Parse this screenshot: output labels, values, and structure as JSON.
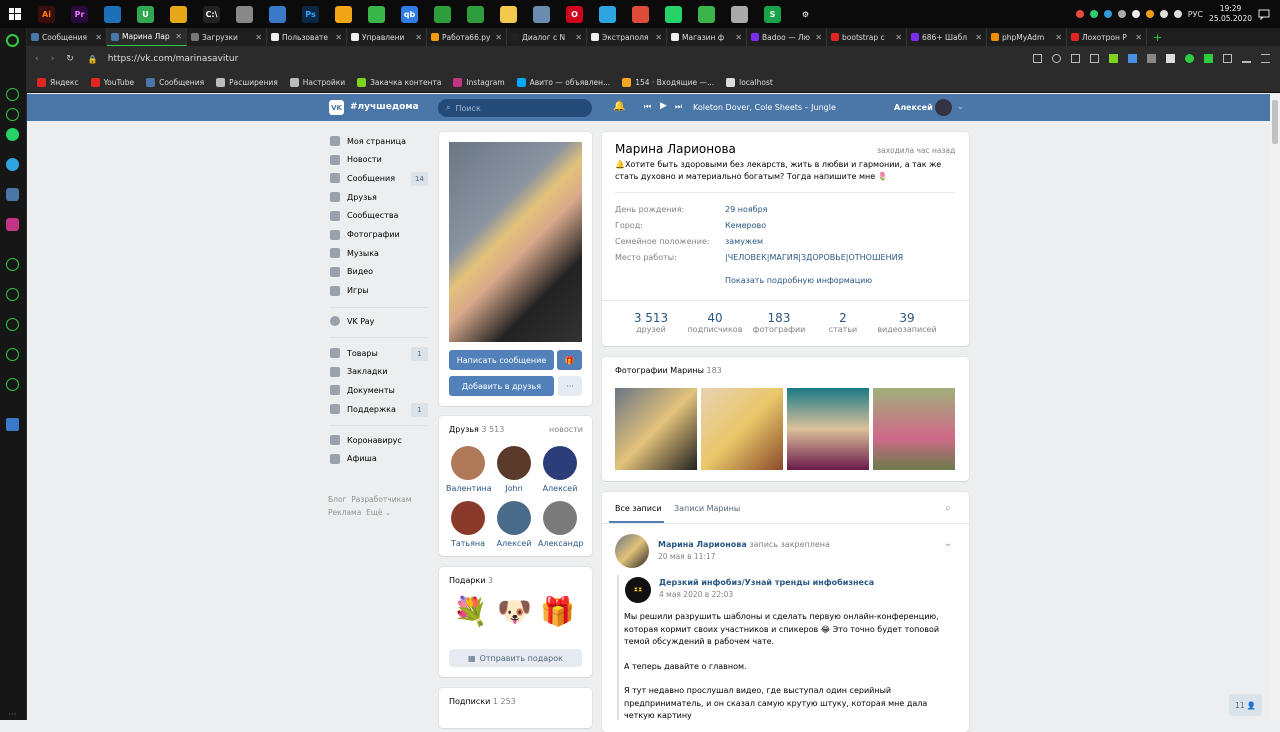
{
  "taskbar": {
    "apps": [
      {
        "label": "Ai",
        "color": "#3b0d0d",
        "fg": "#ff7c00"
      },
      {
        "label": "Pr",
        "color": "#2a0a3d",
        "fg": "#e77bff"
      },
      {
        "label": "",
        "color": "#1d6fb8",
        "fg": "#fff"
      },
      {
        "label": "U",
        "color": "#2fa84f",
        "fg": "#fff"
      },
      {
        "label": "",
        "color": "#e6a817",
        "fg": "#fff"
      },
      {
        "label": "C:\\",
        "color": "#222",
        "fg": "#fff"
      },
      {
        "label": "",
        "color": "#888",
        "fg": "#fff"
      },
      {
        "label": "",
        "color": "#3a78c8",
        "fg": "#fff"
      },
      {
        "label": "Ps",
        "color": "#0b2946",
        "fg": "#31a8ff"
      },
      {
        "label": "",
        "color": "#f2a516",
        "fg": "#fff"
      },
      {
        "label": "",
        "color": "#39b54a",
        "fg": "#fff"
      },
      {
        "label": "qb",
        "color": "#2f7de1",
        "fg": "#fff"
      },
      {
        "label": "",
        "color": "#2e9e3d",
        "fg": "#fff"
      },
      {
        "label": "",
        "color": "#2e9e3d",
        "fg": "#fff"
      },
      {
        "label": "",
        "color": "#f2c94c",
        "fg": "#fff"
      },
      {
        "label": "",
        "color": "#6b8cae",
        "fg": "#fff"
      },
      {
        "label": "O",
        "color": "#d0021b",
        "fg": "#fff"
      },
      {
        "label": "",
        "color": "#2ca5e0",
        "fg": "#fff"
      },
      {
        "label": "",
        "color": "#dd4b39",
        "fg": "#fff"
      },
      {
        "label": "",
        "color": "#25d366",
        "fg": "#fff"
      },
      {
        "label": "",
        "color": "#39b54a",
        "fg": "#fff"
      },
      {
        "label": "",
        "color": "#aaa",
        "fg": "#fff"
      },
      {
        "label": "S",
        "color": "#16a34a",
        "fg": "#fff"
      },
      {
        "label": "⚙",
        "color": "#0b0b0b",
        "fg": "#fff"
      }
    ],
    "lang": "РУС",
    "time": "19:29",
    "date": "25.05.2020"
  },
  "tabs": [
    {
      "title": "Сообщения",
      "color": "#4a76a8"
    },
    {
      "title": "Марина Лар",
      "color": "#4a76a8"
    },
    {
      "title": "Загрузки",
      "color": "#777"
    },
    {
      "title": "Пользовате",
      "color": "#eee"
    },
    {
      "title": "Управлени",
      "color": "#eee"
    },
    {
      "title": "Работа66.ру",
      "color": "#f39c12"
    },
    {
      "title": "Диалог с N",
      "color": "#222"
    },
    {
      "title": "Экстраполя",
      "color": "#eee"
    },
    {
      "title": "Магазин ф",
      "color": "#eee"
    },
    {
      "title": "Badoo — Лю",
      "color": "#7b2cf0"
    },
    {
      "title": "bootstrap с",
      "color": "#e52620"
    },
    {
      "title": "686+ Шабл",
      "color": "#7b2cf0"
    },
    {
      "title": "phpMyAdm",
      "color": "#f28c00"
    },
    {
      "title": "Лохотрон Р",
      "color": "#e52620"
    }
  ],
  "address": {
    "url": "https://vk.com/marinasavitur"
  },
  "bookmarks": [
    {
      "label": "Яндекс",
      "color": "#e52620"
    },
    {
      "label": "YouTube",
      "color": "#e52620"
    },
    {
      "label": "Сообщения",
      "color": "#4a76a8"
    },
    {
      "label": "Расширения",
      "color": "#bbb"
    },
    {
      "label": "Настройки",
      "color": "#bbb"
    },
    {
      "label": "Закачка контента",
      "color": "#7ed321"
    },
    {
      "label": "Instagram",
      "color": "#c13584"
    },
    {
      "label": "Авито — объявлен...",
      "color": "#00aaff"
    },
    {
      "label": "154 · Входящие —...",
      "color": "#f5a623"
    },
    {
      "label": "localhost",
      "color": "#ddd"
    }
  ],
  "vk": {
    "logo_text": "#лучшедома",
    "search_placeholder": "Поиск",
    "track": "Koleton Dover, Cole Sheets – Jungle",
    "user": "Алексей"
  },
  "leftnav": {
    "items": [
      {
        "label": "Моя страница",
        "count": ""
      },
      {
        "label": "Новости",
        "count": ""
      },
      {
        "label": "Сообщения",
        "count": "14"
      },
      {
        "label": "Друзья",
        "count": ""
      },
      {
        "label": "Сообщества",
        "count": ""
      },
      {
        "label": "Фотографии",
        "count": ""
      },
      {
        "label": "Музыка",
        "count": ""
      },
      {
        "label": "Видео",
        "count": ""
      },
      {
        "label": "Игры",
        "count": ""
      }
    ],
    "vkpay": "VK Pay",
    "items2": [
      {
        "label": "Товары",
        "count": "1"
      },
      {
        "label": "Закладки",
        "count": ""
      },
      {
        "label": "Документы",
        "count": ""
      },
      {
        "label": "Поддержка",
        "count": "1"
      }
    ],
    "items3": [
      {
        "label": "Коронавирус"
      },
      {
        "label": "Афиша"
      }
    ],
    "footer": [
      "Блог",
      "Разработчикам",
      "Реклама",
      "Ещё"
    ]
  },
  "profile": {
    "write_btn": "Написать сообщение",
    "add_btn": "Добавить в друзья",
    "more": "···",
    "name": "Марина Ларионова",
    "last_seen": "заходила час назад",
    "status": "🔔Хотите быть здоровыми без лекарств, жить в любви и гармонии, а так же стать духовно и материально богатым? Тогда напишите мне 🌷",
    "info": [
      {
        "k": "День рождения:",
        "v": "29 ноября"
      },
      {
        "k": "Город:",
        "v": "Кемерово"
      },
      {
        "k": "Семейное положение:",
        "v": "замужем"
      },
      {
        "k": "Место работы:",
        "v": "|ЧЕЛОВЕК|МАГИЯ|ЗДОРОВЬЕ|ОТНОШЕНИЯ"
      }
    ],
    "more_info": "Показать подробную информацию",
    "stats": [
      {
        "n": "3 513",
        "l": "друзей"
      },
      {
        "n": "40",
        "l": "подписчиков"
      },
      {
        "n": "183",
        "l": "фотографии"
      },
      {
        "n": "2",
        "l": "статьи"
      },
      {
        "n": "39",
        "l": "видеозаписей"
      }
    ]
  },
  "friends": {
    "title": "Друзья",
    "count": "3 513",
    "news": "новости",
    "list": [
      {
        "name": "Валентина",
        "color": "#b07a5a"
      },
      {
        "name": "John",
        "color": "#5a3a2a"
      },
      {
        "name": "Алексей",
        "color": "#2c3e7a"
      },
      {
        "name": "Татьяна",
        "color": "#8a3a2a"
      },
      {
        "name": "Алексей",
        "color": "#4a6a8a"
      },
      {
        "name": "Александр",
        "color": "#7a7a7a"
      }
    ]
  },
  "gifts": {
    "title": "Подарки",
    "count": "3",
    "send": "Отправить подарок"
  },
  "subs": {
    "title": "Подписки",
    "count": "1 253"
  },
  "photos": {
    "title": "Фотографии Марины",
    "count": "183"
  },
  "wall": {
    "tab_all": "Все записи",
    "tab_own": "Записи Марины",
    "author": "Марина Ларионова",
    "pinned": "запись закреплена",
    "date": "20 мая в 11:17",
    "repost_author": "Дерзкий инфобиз/Узнай тренды инфобизнеса",
    "repost_date": "4 мая 2020 в 22:03",
    "p1": "Мы решили разрушить шаблоны и сделать первую онлайн-конференцию, которая кормит своих участников и спикеров 😂 Это точно будет топовой темой обсуждений в рабочем чате.",
    "p2": "А теперь давайте о главном.",
    "p3": "Я тут недавно прослушал видео, где выступал один серийный предприниматель, и он сказал самую крутую штуку, которая мне дала четкую картину"
  },
  "chat_badge": "11"
}
